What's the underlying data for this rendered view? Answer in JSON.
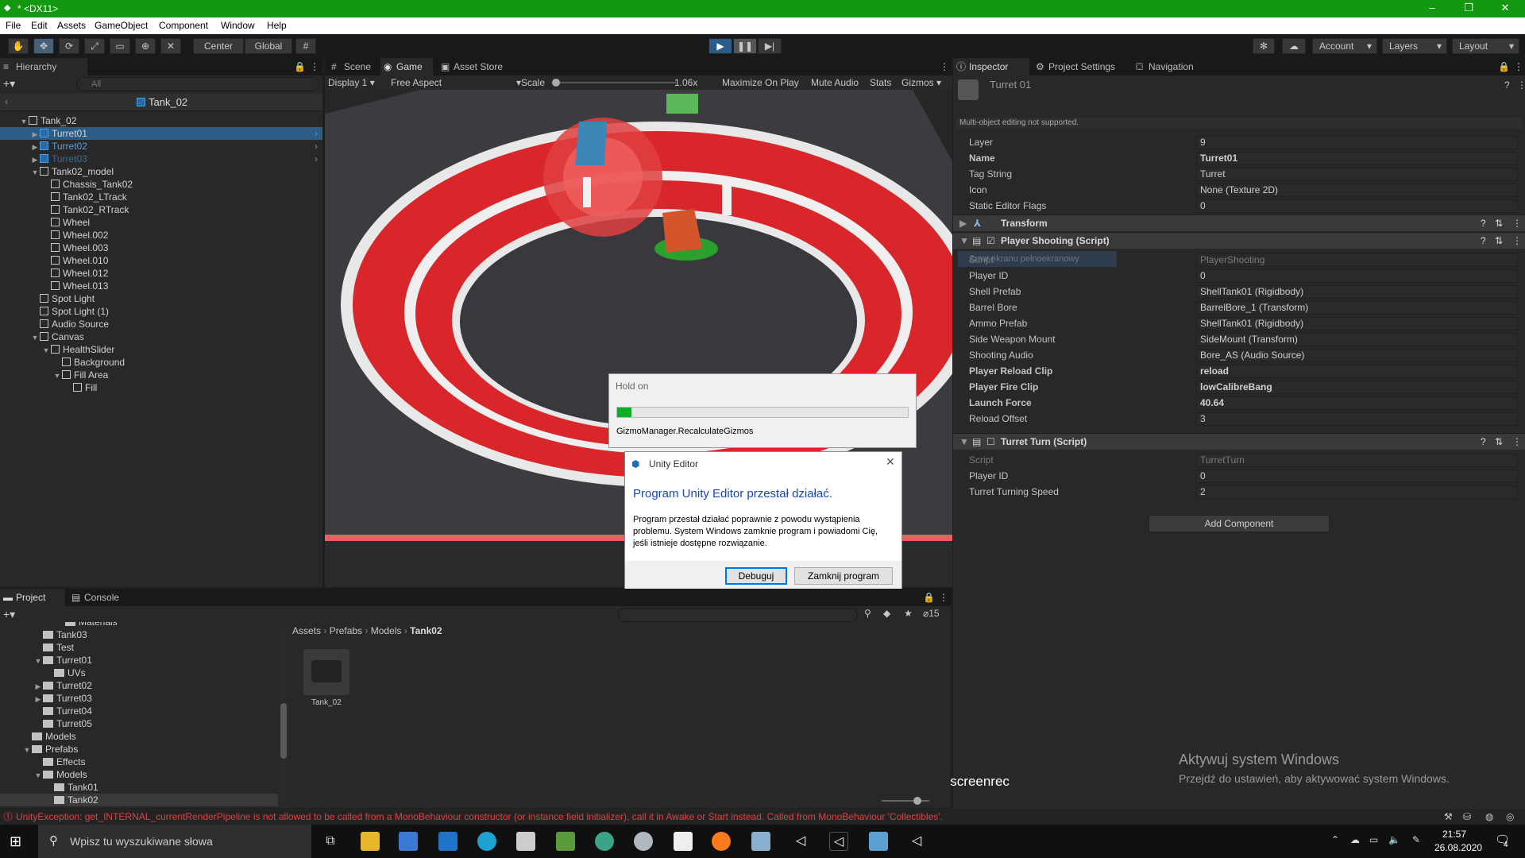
{
  "window": {
    "title": "* <DX11>",
    "min": "–",
    "max": "❐",
    "close": "✕"
  },
  "menu": [
    "File",
    "Edit",
    "Assets",
    "GameObject",
    "Component",
    "Window",
    "Help"
  ],
  "toolbar": {
    "center_label": "Center",
    "global_label": "Global",
    "account_label": "Account",
    "layers_label": "Layers",
    "layout_label": "Layout"
  },
  "hierarchy": {
    "tab_label": "Hierarchy",
    "search_placeholder": "All",
    "prefab_title": "Tank_02",
    "rows": [
      {
        "label": "Tank_02",
        "depth": 0,
        "arrow": "▼",
        "style": "normal"
      },
      {
        "label": "Turret01",
        "depth": 1,
        "arrow": "▶",
        "style": "selected"
      },
      {
        "label": "Turret02",
        "depth": 1,
        "arrow": "▶",
        "style": "blue"
      },
      {
        "label": "Turret03",
        "depth": 1,
        "arrow": "▶",
        "style": "blue-dim"
      },
      {
        "label": "Tank02_model",
        "depth": 1,
        "arrow": "▼",
        "style": "normal"
      },
      {
        "label": "Chassis_Tank02",
        "depth": 2,
        "arrow": "",
        "style": "normal"
      },
      {
        "label": "Tank02_LTrack",
        "depth": 2,
        "arrow": "",
        "style": "normal"
      },
      {
        "label": "Tank02_RTrack",
        "depth": 2,
        "arrow": "",
        "style": "normal"
      },
      {
        "label": "Wheel",
        "depth": 2,
        "arrow": "",
        "style": "normal"
      },
      {
        "label": "Wheel.002",
        "depth": 2,
        "arrow": "",
        "style": "normal"
      },
      {
        "label": "Wheel.003",
        "depth": 2,
        "arrow": "",
        "style": "normal"
      },
      {
        "label": "Wheel.010",
        "depth": 2,
        "arrow": "",
        "style": "normal"
      },
      {
        "label": "Wheel.012",
        "depth": 2,
        "arrow": "",
        "style": "normal"
      },
      {
        "label": "Wheel.013",
        "depth": 2,
        "arrow": "",
        "style": "normal"
      },
      {
        "label": "Spot Light",
        "depth": 1,
        "arrow": "",
        "style": "normal"
      },
      {
        "label": "Spot Light (1)",
        "depth": 1,
        "arrow": "",
        "style": "normal"
      },
      {
        "label": "Audio Source",
        "depth": 1,
        "arrow": "",
        "style": "normal"
      },
      {
        "label": "Canvas",
        "depth": 1,
        "arrow": "▼",
        "style": "normal"
      },
      {
        "label": "HealthSlider",
        "depth": 2,
        "arrow": "▼",
        "style": "normal"
      },
      {
        "label": "Background",
        "depth": 3,
        "arrow": "",
        "style": "normal"
      },
      {
        "label": "Fill Area",
        "depth": 3,
        "arrow": "▼",
        "style": "normal"
      },
      {
        "label": "Fill",
        "depth": 4,
        "arrow": "",
        "style": "normal"
      }
    ]
  },
  "center_tabs": {
    "scene": "Scene",
    "game": "Game",
    "asset_store": "Asset Store"
  },
  "game_bar": {
    "display": "Display 1",
    "aspect": "Free Aspect",
    "scale_label": "Scale",
    "scale_value": "1.06x",
    "maximize": "Maximize On Play",
    "mute": "Mute Audio",
    "stats": "Stats",
    "gizmos": "Gizmos"
  },
  "hold_dialog": {
    "title": "Hold on",
    "progress": 0.05,
    "message": "GizmoManager.RecalculateGizmos"
  },
  "crash_dialog": {
    "title": "Unity Editor",
    "heading": "Program Unity Editor przestał działać.",
    "body": "Program przestał działać poprawnie z powodu wystąpienia problemu. System Windows zamknie program i powiadomi Cię, jeśli istnieje dostępne rozwiązanie.",
    "debug_button": "Debuguj",
    "close_button": "Zamknij program"
  },
  "inspector": {
    "tabs": {
      "inspector": "Inspector",
      "project_settings": "Project Settings",
      "navigation": "Navigation"
    },
    "object_name": "Turret 01",
    "multi_notice": "Multi-object editing not supported.",
    "fields": [
      {
        "label": "Layer",
        "value": "9"
      },
      {
        "label": "Name",
        "value": "Turret01",
        "bold": true
      },
      {
        "label": "Tag String",
        "value": "Turret"
      },
      {
        "label": "Icon",
        "value": "None (Texture 2D)"
      },
      {
        "label": "Static Editor Flags",
        "value": "0"
      }
    ],
    "transform_label": "Transform",
    "player_shooting": {
      "title": "Player Shooting (Script)",
      "tooltip_ghost": "Zrzut ekranu pełnoekranowy",
      "fields": [
        {
          "label": "Script",
          "value": "PlayerShooting",
          "dim": true
        },
        {
          "label": "Player ID",
          "value": "0"
        },
        {
          "label": "Shell Prefab",
          "value": "ShellTank01 (Rigidbody)"
        },
        {
          "label": "Barrel Bore",
          "value": "BarrelBore_1 (Transform)"
        },
        {
          "label": "Ammo Prefab",
          "value": "ShellTank01 (Rigidbody)"
        },
        {
          "label": "Side Weapon Mount",
          "value": "SideMount (Transform)"
        },
        {
          "label": "Shooting Audio",
          "value": "Bore_AS (Audio Source)"
        },
        {
          "label": "Player Reload Clip",
          "value": "reload",
          "bold": true
        },
        {
          "label": "Player Fire Clip",
          "value": "lowCalibreBang",
          "bold": true
        },
        {
          "label": "Launch Force",
          "value": "40.64",
          "bold": true
        },
        {
          "label": "Reload Offset",
          "value": "3"
        }
      ]
    },
    "turret_turn": {
      "title": "Turret Turn (Script)",
      "fields": [
        {
          "label": "Script",
          "value": "TurretTurn",
          "dim": true
        },
        {
          "label": "Player ID",
          "value": "0"
        },
        {
          "label": "Turret Turning Speed",
          "value": "2"
        }
      ]
    },
    "add_component": "Add Component"
  },
  "watermark": {
    "line1": "Aktywuj system Windows",
    "line2": "Przejdź do ustawień, aby aktywować system Windows.",
    "screenrec": "screenrec"
  },
  "project": {
    "tab_project": "Project",
    "tab_console": "Console",
    "hidden_count": "15",
    "breadcrumb": [
      "Assets",
      "Prefabs",
      "Models",
      "Tank02"
    ],
    "tree": [
      {
        "label": "Materials",
        "depth": 4,
        "arrow": ""
      },
      {
        "label": "Tank03",
        "depth": 2,
        "arrow": ""
      },
      {
        "label": "Test",
        "depth": 2,
        "arrow": ""
      },
      {
        "label": "Turret01",
        "depth": 2,
        "arrow": "▼"
      },
      {
        "label": "UVs",
        "depth": 3,
        "arrow": ""
      },
      {
        "label": "Turret02",
        "depth": 2,
        "arrow": "▶"
      },
      {
        "label": "Turret03",
        "depth": 2,
        "arrow": "▶"
      },
      {
        "label": "Turret04",
        "depth": 2,
        "arrow": ""
      },
      {
        "label": "Turret05",
        "depth": 2,
        "arrow": ""
      },
      {
        "label": "Models",
        "depth": 1,
        "arrow": ""
      },
      {
        "label": "Prefabs",
        "depth": 1,
        "arrow": "▼"
      },
      {
        "label": "Effects",
        "depth": 2,
        "arrow": ""
      },
      {
        "label": "Models",
        "depth": 2,
        "arrow": "▼"
      },
      {
        "label": "Tank01",
        "depth": 3,
        "arrow": ""
      },
      {
        "label": "Tank02",
        "depth": 3,
        "arrow": ""
      }
    ],
    "asset_label": "Tank_02"
  },
  "status_bar": {
    "error": "UnityException: get_INTERNAL_currentRenderPipeline is not allowed to be called from a MonoBehaviour constructor (or instance field initializer), call it in Awake or Start instead. Called from MonoBehaviour 'Collectibles'."
  },
  "taskbar": {
    "search_placeholder": "Wpisz tu wyszukiwane słowa",
    "time": "21:57",
    "date": "26.08.2020",
    "notification_count": "4"
  },
  "colors": {
    "titlebar": "#13990f",
    "selection": "#2c5d87",
    "error": "#e04040"
  }
}
